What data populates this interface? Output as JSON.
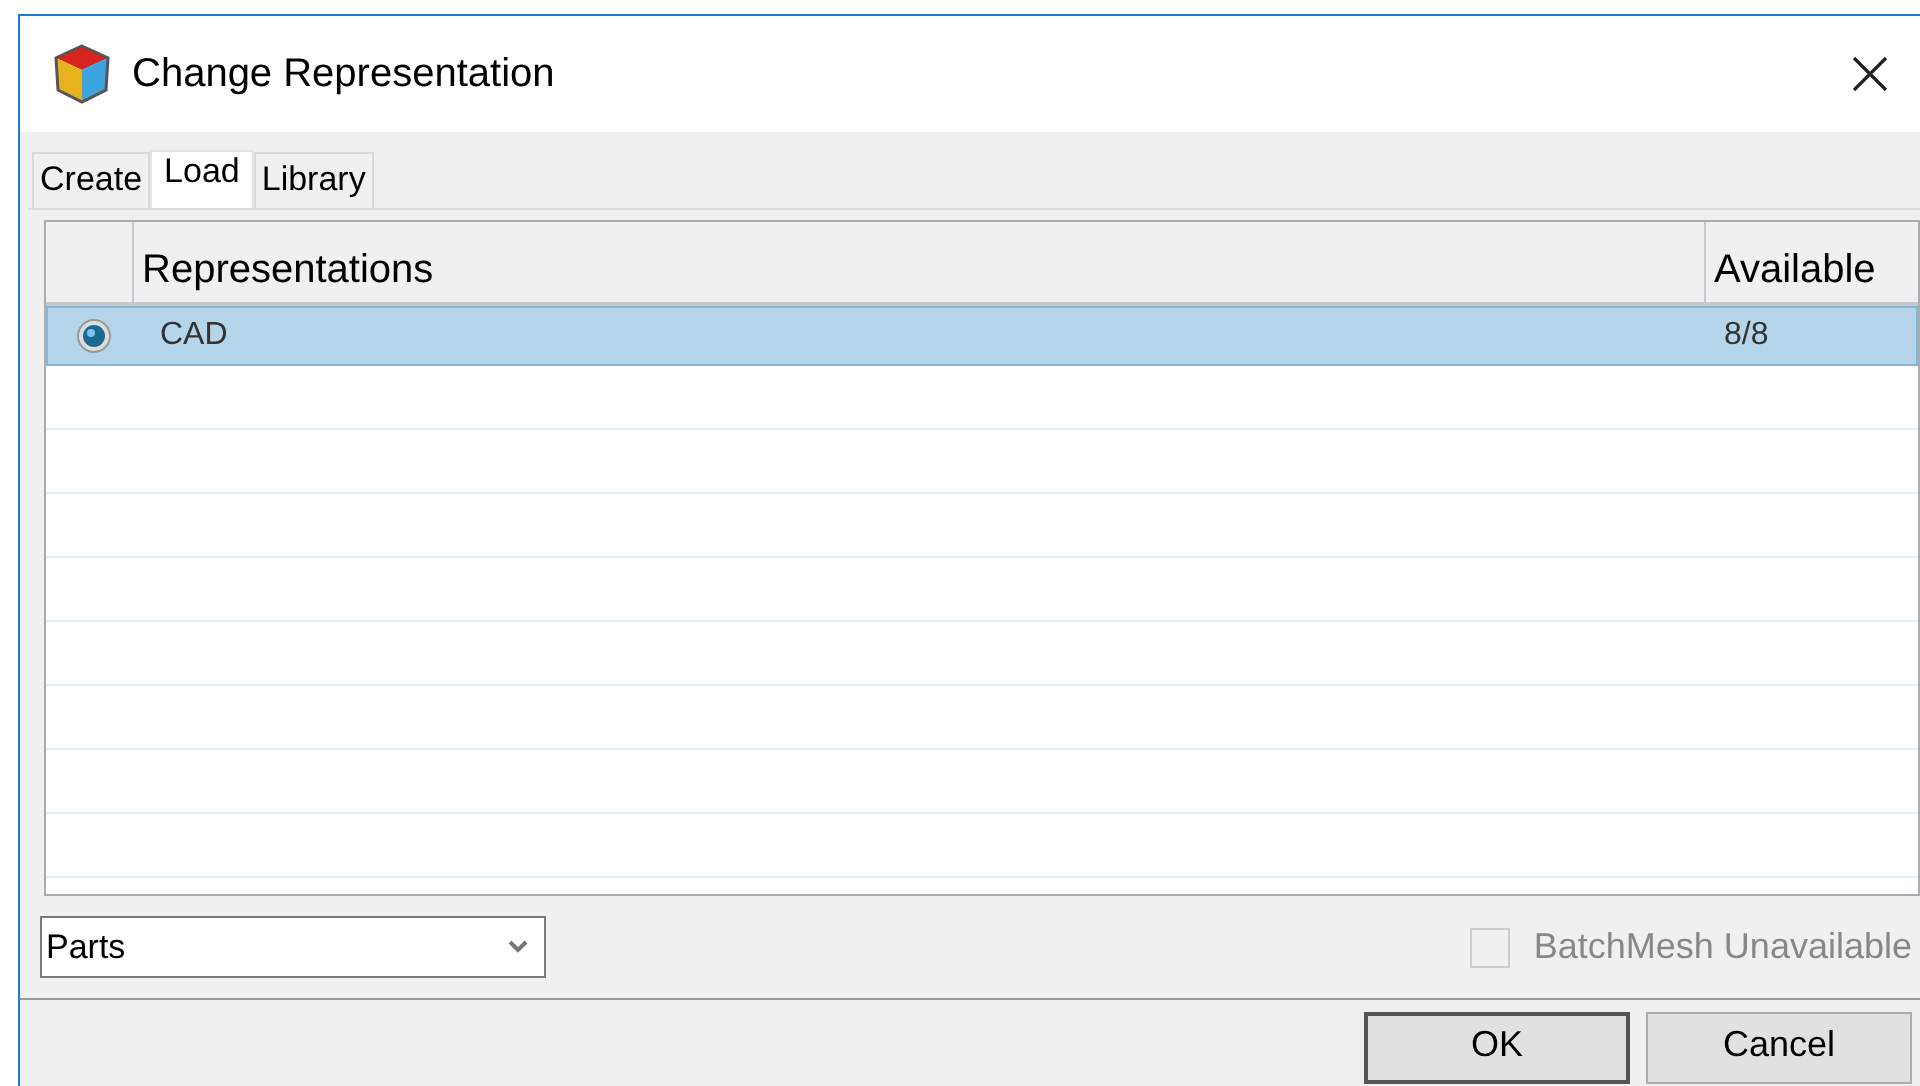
{
  "window": {
    "title": "Change Representation"
  },
  "tabs": [
    {
      "label": "Create",
      "selected": false
    },
    {
      "label": "Load",
      "selected": true
    },
    {
      "label": "Library",
      "selected": false
    }
  ],
  "table": {
    "columns": [
      "Representations",
      "Available"
    ],
    "rows": [
      {
        "name": "CAD",
        "available": "8/8",
        "selected": true
      }
    ]
  },
  "dropdown": {
    "value": "Parts"
  },
  "checkbox": {
    "label": "BatchMesh Unavailable",
    "checked": false,
    "disabled": true
  },
  "buttons": [
    {
      "label": "OK",
      "default": true
    },
    {
      "label": "Cancel",
      "default": false
    }
  ]
}
